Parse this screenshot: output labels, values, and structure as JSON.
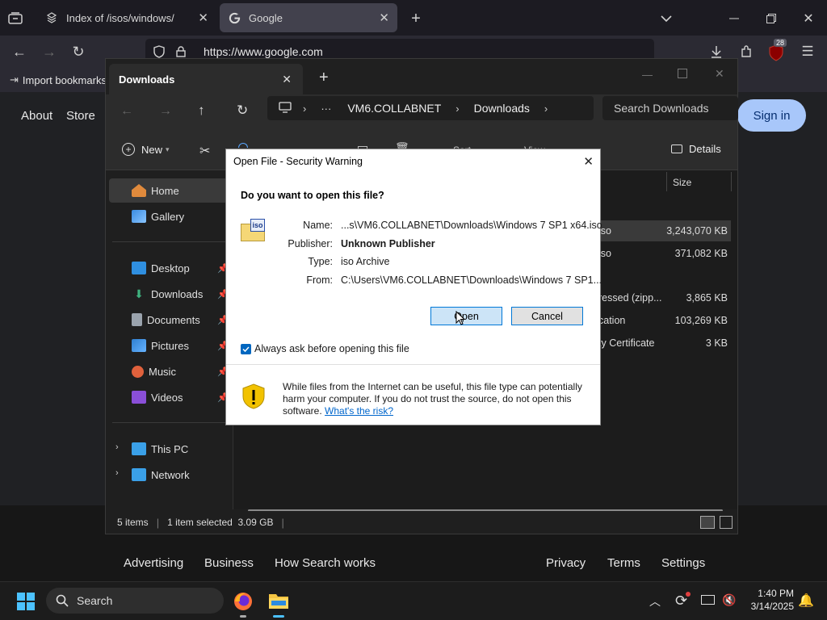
{
  "browser": {
    "tabs": [
      {
        "title": "Index of /isos/windows/"
      },
      {
        "title": "Google"
      }
    ],
    "url": "https://www.google.com",
    "notification_count": "28",
    "bookmark_import_label": "Import bookmarks"
  },
  "google": {
    "top_links": [
      "About",
      "Store"
    ],
    "sign_in": "Sign in",
    "footer_left": [
      "Advertising",
      "Business",
      "How Search works"
    ],
    "footer_right": [
      "Privacy",
      "Terms",
      "Settings"
    ]
  },
  "explorer": {
    "tab_title": "Downloads",
    "breadcrumb": [
      "VM6.COLLABNET",
      "Downloads"
    ],
    "ellipsis": "···",
    "search_placeholder": "Search Downloads",
    "new_label": "New",
    "sort_label": "Sort",
    "view_label": "View",
    "details_label": "Details",
    "size_header": "Size",
    "nav": {
      "home": "Home",
      "gallery": "Gallery",
      "desktop": "Desktop",
      "downloads": "Downloads",
      "documents": "Documents",
      "pictures": "Pictures",
      "music": "Music",
      "videos": "Videos",
      "this_pc": "This PC",
      "network": "Network"
    },
    "rows": [
      {
        "type": "iso",
        "size": "3,243,070 KB"
      },
      {
        "type": "iso",
        "size": "371,082 KB"
      },
      {
        "type": "ressed (zipp...",
        "size": "3,865 KB"
      },
      {
        "type": "cation",
        "size": "103,269 KB"
      },
      {
        "type": "ty Certificate",
        "size": "3 KB"
      }
    ],
    "status": {
      "items": "5 items",
      "selected": "1 item selected  3.09 GB"
    }
  },
  "dialog": {
    "title": "Open File - Security Warning",
    "question": "Do you want to open this file?",
    "icon_text": "iso",
    "labels": {
      "name": "Name:",
      "publisher": "Publisher:",
      "type": "Type:",
      "from": "From:"
    },
    "values": {
      "name": "...s\\VM6.COLLABNET\\Downloads\\Windows 7 SP1 x64.iso",
      "publisher": "Unknown Publisher",
      "type": "iso Archive",
      "from": "C:\\Users\\VM6.COLLABNET\\Downloads\\Windows 7 SP1..."
    },
    "open_button": "Open",
    "cancel_button": "Cancel",
    "checkbox_label": "Always ask before opening this file",
    "checkbox_checked": true,
    "warning_text": "While files from the Internet can be useful, this file type can potentially harm your computer. If you do not trust the source, do not open this software.",
    "risk_link": "What's the risk?"
  },
  "taskbar": {
    "search": "Search",
    "time": "1:40 PM",
    "date": "3/14/2025"
  },
  "colors": {
    "accent": "#a8c7fa",
    "checkbox": "#0067c0",
    "link": "#0066cc",
    "shield": "#f2c200"
  }
}
